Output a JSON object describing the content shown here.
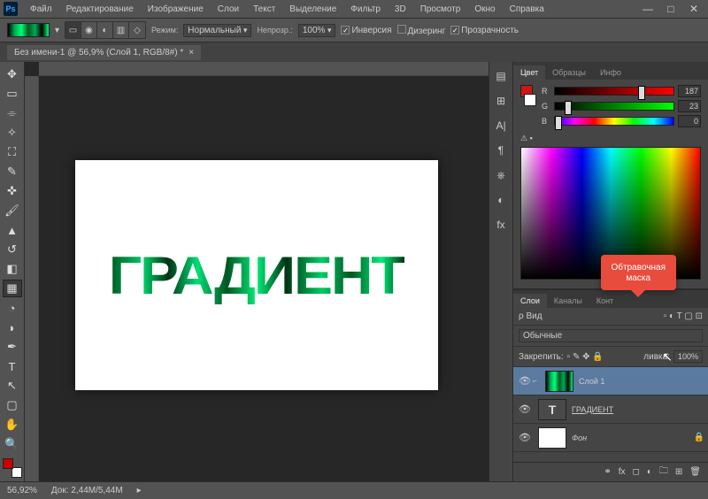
{
  "app": {
    "logo": "Ps"
  },
  "menu": [
    "Файл",
    "Редактирование",
    "Изображение",
    "Слои",
    "Текст",
    "Выделение",
    "Фильтр",
    "3D",
    "Просмотр",
    "Окно",
    "Справка"
  ],
  "optbar": {
    "mode_label": "Режим:",
    "mode_value": "Нормальный",
    "opacity_label": "Непрозр.:",
    "opacity_value": "100%",
    "inverse": "Инверсия",
    "dither": "Дизеринг",
    "transparency": "Прозрачность"
  },
  "document": {
    "tab_title": "Без имени-1 @ 56,9% (Слой 1, RGB/8#) *",
    "canvas_text": "ГРАДИЕНТ"
  },
  "color_panel": {
    "tabs": [
      "Цвет",
      "Образцы",
      "Инфо"
    ],
    "r_label": "R",
    "r_value": "187",
    "g_label": "G",
    "g_value": "23",
    "b_label": "B",
    "b_value": "0"
  },
  "layers_panel": {
    "tabs": [
      "Слои",
      "Каналы",
      "Конт"
    ],
    "kind_label": "ρ Вид",
    "blend_mode": "Обычные",
    "lock_label": "Закрепить:",
    "fill_label": "ливка:",
    "fill_value": "100%",
    "layers": [
      {
        "name": "Слой 1",
        "type": "gradient",
        "selected": true,
        "visible": true
      },
      {
        "name": "ГРАДИЕНТ",
        "type": "text",
        "selected": false,
        "visible": true,
        "underline": true
      },
      {
        "name": "Фон",
        "type": "bg",
        "selected": false,
        "visible": true,
        "locked": true
      }
    ]
  },
  "status": {
    "zoom": "56,92%",
    "doc": "Док: 2,44M/5,44M"
  },
  "tooltip": {
    "line1": "Обтравочная",
    "line2": "маска"
  }
}
